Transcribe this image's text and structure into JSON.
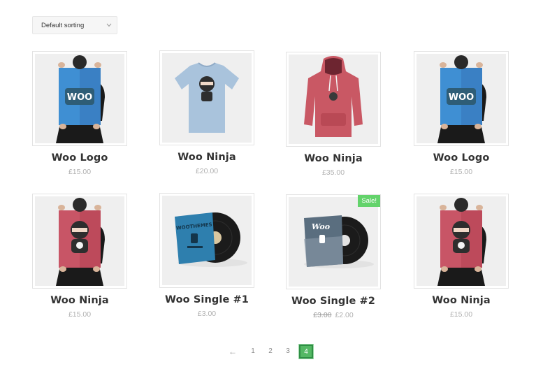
{
  "sorting": {
    "selected": "Default sorting"
  },
  "products": [
    {
      "title": "Woo Logo",
      "price": "£15.00"
    },
    {
      "title": "Woo Ninja",
      "price": "£20.00"
    },
    {
      "title": "Woo Ninja",
      "price": "£35.00"
    },
    {
      "title": "Woo Logo",
      "price": "£15.00"
    },
    {
      "title": "Woo Ninja",
      "price": "£15.00"
    },
    {
      "title": "Woo Single #1",
      "price": "£3.00"
    },
    {
      "title": "Woo Single #2",
      "old_price": "£3.00",
      "price": "£2.00",
      "badge": "Sale!"
    },
    {
      "title": "Woo Ninja",
      "price": "£15.00"
    }
  ],
  "images": {
    "poster_woo_logo": "WOO",
    "album_woothemes": "WOOTHEMES",
    "album_woo": "Woo"
  },
  "pagination": {
    "prev": "←",
    "pages": [
      "1",
      "2",
      "3"
    ],
    "current": "4"
  },
  "colors": {
    "sale": "#63d36b",
    "current_page": "#54b864",
    "text": "#333333",
    "price": "#b0b0b0"
  }
}
